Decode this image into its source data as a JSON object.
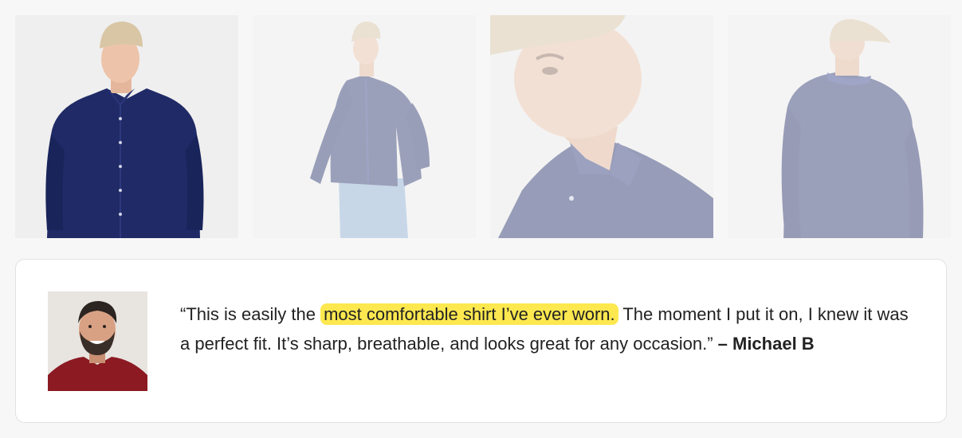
{
  "gallery": {
    "images": [
      {
        "icon": "product-photo-front-icon",
        "active": true
      },
      {
        "icon": "product-photo-side-icon",
        "active": false
      },
      {
        "icon": "product-photo-closeup-icon",
        "active": false
      },
      {
        "icon": "product-photo-back-icon",
        "active": false
      }
    ]
  },
  "review": {
    "quote_start": "“This is easily the ",
    "highlight": "most comfortable shirt I’ve ever worn.",
    "quote_end": " The moment I put it on, I knew it was a perfect fit. It’s sharp, breathable, and looks great for any occasion.”",
    "author": " – Michael B",
    "avatar_icon": "reviewer-avatar-icon"
  },
  "colors": {
    "background": "#f7f7f7",
    "card": "#ffffff",
    "highlight": "#fde84f",
    "shirt": "#1f2a66"
  }
}
